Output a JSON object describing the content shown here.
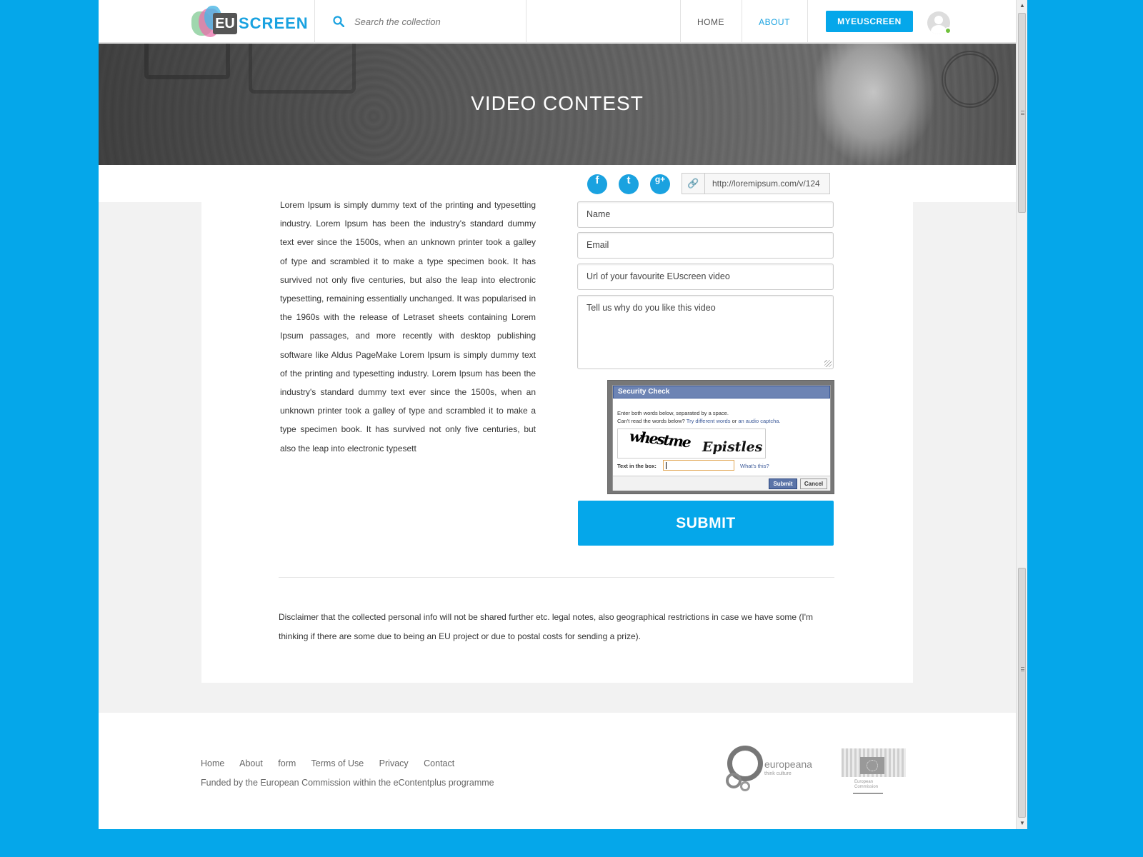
{
  "header": {
    "logo": {
      "eu": "EU",
      "screen": "SCREEN"
    },
    "search": {
      "placeholder": "Search the collection"
    },
    "nav": {
      "home": "HOME",
      "about": "ABOUT"
    },
    "my_button": "MYEUSCREEN"
  },
  "hero": {
    "title": "VIDEO CONTEST"
  },
  "share": {
    "social": {
      "facebook": "f",
      "twitter": "t",
      "google": "g+"
    },
    "url": "http://loremipsum.com/v/124"
  },
  "body_text": "Lorem Ipsum is simply dummy text of the printing and typesetting industry. Lorem Ipsum has been the industry's standard dummy text ever since the 1500s, when an unknown printer took a galley of type and scrambled it to make a type specimen book. It has survived not only five centuries, but also the leap into electronic typesetting, remaining essentially unchanged. It was popularised in the 1960s with the release of Letraset sheets containing Lorem Ipsum passages, and more recently with desktop publishing software like Aldus PageMake Lorem Ipsum is simply dummy text of the printing and typesetting industry. Lorem Ipsum has been the industry's standard dummy text ever since the 1500s, when an unknown printer took a galley of type and scrambled it to make a type specimen book. It has survived not only five centuries, but also the leap into electronic typesett",
  "form": {
    "name_placeholder": "Name",
    "email_placeholder": "Email",
    "url_placeholder": "Url of your favourite EUscreen video",
    "why_placeholder": "Tell us why do you like this video",
    "submit": "SUBMIT"
  },
  "captcha": {
    "title": "Security Check",
    "instruction1": "Enter both words below, separated by a space.",
    "instruction2_prefix": "Can't read the words below?",
    "instruction2_link1": "Try different words",
    "instruction2_mid": "or",
    "instruction2_link2": "an audio captcha.",
    "word1": "whestme",
    "word2": "Epistles",
    "label": "Text in the box:",
    "whats_this": "What's this?",
    "submit": "Submit",
    "cancel": "Cancel"
  },
  "disclaimer": "Disclaimer that the collected personal info will not be shared further etc. legal notes, also geographical restrictions in case we have some (I'm thinking if there are some due to being an EU project or due to postal costs for sending a prize).",
  "footer": {
    "links": [
      "Home",
      "About",
      "form",
      "Terms of Use",
      "Privacy",
      "Contact"
    ],
    "funded": "Funded by the European Commission within the eContentplus programme",
    "europeana_name": "europeana",
    "europeana_tagline": "think culture",
    "commission_line1": "European",
    "commission_line2": "Commission"
  },
  "colors": {
    "accent": "#05a7ea",
    "background": "#05a7ea"
  }
}
